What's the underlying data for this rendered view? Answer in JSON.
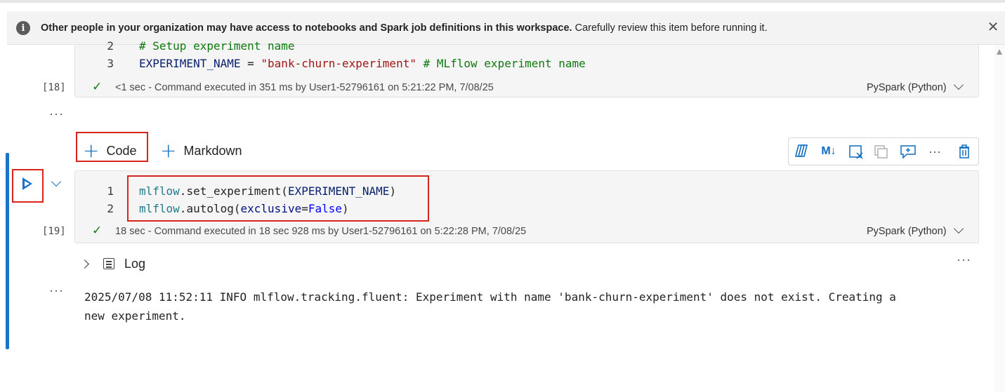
{
  "banner": {
    "info_icon": "i",
    "bold_text": "Other people in your organization may have access to notebooks and Spark job definitions in this workspace.",
    "normal_text": " Carefully review this item before running it.",
    "close_icon": "✕"
  },
  "cell18": {
    "exec_count": "[18]",
    "lines": [
      {
        "num": "2",
        "comment": "# Setup experiment name"
      },
      {
        "num": "3",
        "var": "EXPERIMENT_NAME",
        "op": " = ",
        "str": "\"bank-churn-experiment\"",
        "comment": "  # MLflow experiment name"
      }
    ],
    "status_duration": "<1 sec",
    "status_text": " - Command executed in 351 ms by User1-52796161 on 5:21:22 PM, 7/08/25",
    "language": "PySpark (Python)"
  },
  "more_dots": "···",
  "add_cell": {
    "code_label": "Code",
    "markdown_label": "Markdown"
  },
  "toolbar": {
    "icons": [
      "copilot-icon",
      "markdown-toggle-icon",
      "clear-output-icon",
      "duplicate-icon",
      "comment-icon",
      "more-icon",
      "delete-icon"
    ],
    "md_label": "M↓",
    "more_label": "···"
  },
  "cell19": {
    "exec_count": "[19]",
    "lines": [
      {
        "num": "1",
        "obj": "mlflow",
        "dot": ".",
        "fn": "set_experiment",
        "open": "(",
        "arg": "EXPERIMENT_NAME",
        "close": ")"
      },
      {
        "num": "2",
        "obj": "mlflow",
        "dot": ".",
        "fn": "autolog",
        "open": "(",
        "arg": "exclusive",
        "eq": "=",
        "val": "False",
        "close": ")"
      }
    ],
    "status_duration": "18 sec",
    "status_text": " - Command executed in 18 sec 928 ms by User1-52796161 on 5:22:28 PM, 7/08/25",
    "language": "PySpark (Python)"
  },
  "log": {
    "label": "Log",
    "output": "2025/07/08 11:52:11 INFO mlflow.tracking.fluent: Experiment with name 'bank-churn-experiment' does not exist. Creating a\nnew experiment."
  },
  "colors": {
    "accent": "#0f6cbd",
    "highlight": "#d9241c",
    "success": "#107c10"
  }
}
